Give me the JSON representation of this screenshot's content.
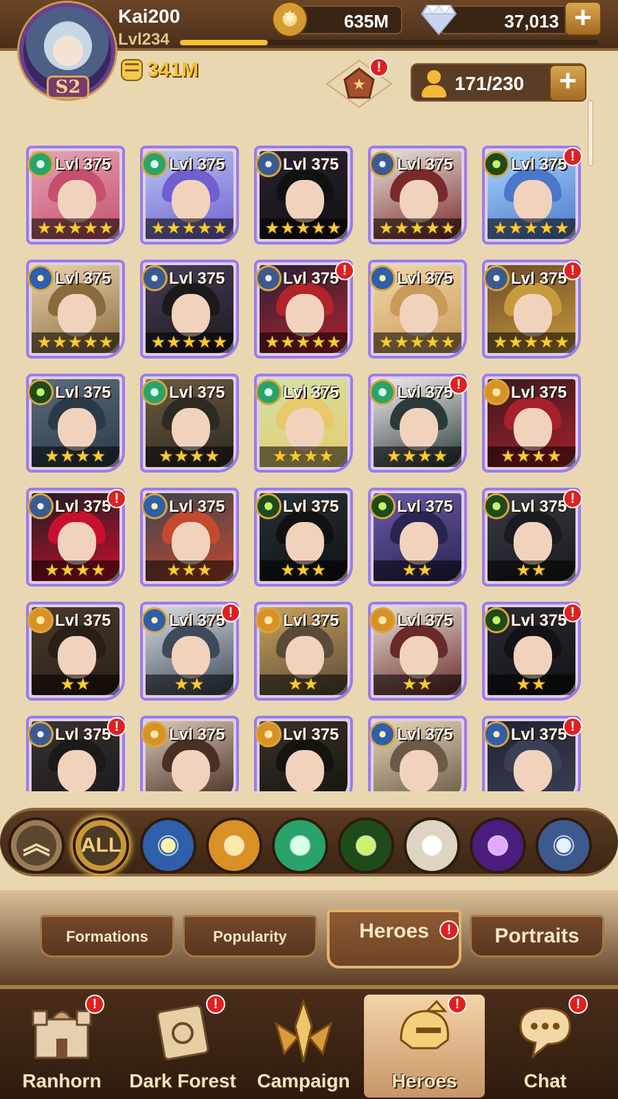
{
  "player": {
    "name": "Kai200",
    "level": "Lvl234",
    "season": "S2",
    "power": "341M",
    "xp_progress": 0.21
  },
  "resources": {
    "gold": "635M",
    "diamonds": "37,013",
    "hero_slots": "171/230"
  },
  "icons": {
    "gold": "gold-coin-icon",
    "diamond": "diamond-icon",
    "power": "fist-icon",
    "slots": "person-icon",
    "emblem": "emblem-icon"
  },
  "colors": {
    "alert": "#e02020",
    "card_border": "#9c7be8",
    "star": "#f8cd2f",
    "header": "#5a3a22"
  },
  "heroes": [
    {
      "level": "Lvl 375",
      "stars": "★★★★★",
      "faction": "wilder",
      "alert": false,
      "palette": [
        "#e7a3b6",
        "#c54f6d"
      ]
    },
    {
      "level": "Lvl 375",
      "stars": "★★★★★",
      "faction": "wilder",
      "alert": false,
      "palette": [
        "#b9c8f2",
        "#6f5fd0"
      ]
    },
    {
      "level": "Lvl 375",
      "stars": "★★★★★",
      "faction": "dimensional",
      "alert": false,
      "palette": [
        "#2a2130",
        "#111"
      ]
    },
    {
      "level": "Lvl 375",
      "stars": "★★★★★",
      "faction": "dimensional",
      "alert": false,
      "palette": [
        "#e9e4de",
        "#7a2a2a"
      ]
    },
    {
      "level": "Lvl 375",
      "stars": "★★★★★",
      "faction": "graveborn",
      "alert": true,
      "palette": [
        "#a8d6ff",
        "#4b77c9"
      ]
    },
    {
      "level": "Lvl 375",
      "stars": "★★★★★",
      "faction": "lightbearer",
      "alert": false,
      "palette": [
        "#e9d5b0",
        "#8a6b3d"
      ]
    },
    {
      "level": "Lvl 375",
      "stars": "★★★★★",
      "faction": "dimensional",
      "alert": false,
      "palette": [
        "#4a3b5e",
        "#1a1a1a"
      ]
    },
    {
      "level": "Lvl 375",
      "stars": "★★★★★",
      "faction": "dimensional",
      "alert": true,
      "palette": [
        "#27203a",
        "#b2232b"
      ]
    },
    {
      "level": "Lvl 375",
      "stars": "★★★★★",
      "faction": "lightbearer",
      "alert": false,
      "palette": [
        "#f2d8a8",
        "#c99a5a"
      ]
    },
    {
      "level": "Lvl 375",
      "stars": "★★★★★",
      "faction": "dimensional",
      "alert": true,
      "palette": [
        "#6b4a2a",
        "#c79a3c"
      ]
    },
    {
      "level": "Lvl 375",
      "stars": "★★★★",
      "faction": "graveborn",
      "alert": false,
      "palette": [
        "#5a6c7c",
        "#2a3a48"
      ]
    },
    {
      "level": "Lvl 375",
      "stars": "★★★★",
      "faction": "wilder",
      "alert": false,
      "palette": [
        "#6d5a3f",
        "#2d2a22"
      ]
    },
    {
      "level": "Lvl 375",
      "stars": "★★★★",
      "faction": "wilder",
      "alert": false,
      "palette": [
        "#cfe3a8",
        "#e9c86a"
      ]
    },
    {
      "level": "Lvl 375",
      "stars": "★★★★",
      "faction": "wilder",
      "alert": true,
      "palette": [
        "#f3eef0",
        "#2a3a3a"
      ]
    },
    {
      "level": "Lvl 375",
      "stars": "★★★★",
      "faction": "mauler",
      "alert": false,
      "palette": [
        "#3a1a1e",
        "#a7202c"
      ]
    },
    {
      "level": "Lvl 375",
      "stars": "★★★★",
      "faction": "dimensional",
      "alert": true,
      "palette": [
        "#1d1d24",
        "#c8102e"
      ]
    },
    {
      "level": "Lvl 375",
      "stars": "★★★",
      "faction": "lightbearer",
      "alert": false,
      "palette": [
        "#3a4450",
        "#c44a2d"
      ]
    },
    {
      "level": "Lvl 375",
      "stars": "★★★",
      "faction": "graveborn",
      "alert": false,
      "palette": [
        "#26323a",
        "#111"
      ]
    },
    {
      "level": "Lvl 375",
      "stars": "★★",
      "faction": "graveborn",
      "alert": false,
      "palette": [
        "#6a5aa8",
        "#2a2450"
      ]
    },
    {
      "level": "Lvl 375",
      "stars": "★★",
      "faction": "graveborn",
      "alert": true,
      "palette": [
        "#3a3a44",
        "#1a1a20"
      ]
    },
    {
      "level": "Lvl 375",
      "stars": "★★",
      "faction": "mauler",
      "alert": false,
      "palette": [
        "#4a3a2c",
        "#2a1f16"
      ]
    },
    {
      "level": "Lvl 375",
      "stars": "★★",
      "faction": "lightbearer",
      "alert": true,
      "palette": [
        "#d8dce0",
        "#3d4a5a"
      ]
    },
    {
      "level": "Lvl 375",
      "stars": "★★",
      "faction": "mauler",
      "alert": false,
      "palette": [
        "#caa25a",
        "#5a4a38"
      ]
    },
    {
      "level": "Lvl 375",
      "stars": "★★",
      "faction": "mauler",
      "alert": false,
      "palette": [
        "#e8e2d8",
        "#6a2a2a"
      ]
    },
    {
      "level": "Lvl 375",
      "stars": "★★",
      "faction": "graveborn",
      "alert": true,
      "palette": [
        "#2a2a32",
        "#121216"
      ]
    },
    {
      "level": "Lvl 375",
      "stars": "",
      "faction": "dimensional",
      "alert": true,
      "palette": [
        "#3a3232",
        "#1a1a1a"
      ]
    },
    {
      "level": "Lvl 375",
      "stars": "",
      "faction": "mauler",
      "alert": false,
      "palette": [
        "#d8c8b4",
        "#4a2f26"
      ]
    },
    {
      "level": "Lvl 375",
      "stars": "",
      "faction": "mauler",
      "alert": false,
      "palette": [
        "#3a3228",
        "#151310"
      ]
    },
    {
      "level": "Lvl 375",
      "stars": "",
      "faction": "lightbearer",
      "alert": false,
      "palette": [
        "#e8d8b8",
        "#6a5a48"
      ]
    },
    {
      "level": "Lvl 375",
      "stars": "",
      "faction": "lightbearer",
      "alert": true,
      "palette": [
        "#1f2230",
        "#3a3f55"
      ]
    }
  ],
  "filters": [
    {
      "name": "collapse",
      "label": "︽"
    },
    {
      "name": "all",
      "label": "ALL"
    },
    {
      "name": "lightbearer"
    },
    {
      "name": "mauler"
    },
    {
      "name": "wilder"
    },
    {
      "name": "graveborn"
    },
    {
      "name": "celestial"
    },
    {
      "name": "hypogean"
    },
    {
      "name": "dimensional"
    }
  ],
  "subtabs": [
    {
      "label": "Formations",
      "active": false,
      "alert": false
    },
    {
      "label": "Popularity",
      "active": false,
      "alert": false
    },
    {
      "label": "Heroes",
      "active": true,
      "alert": true
    },
    {
      "label": "Portraits",
      "active": false,
      "alert": false
    }
  ],
  "nav": [
    {
      "label": "Ranhorn",
      "alert": true,
      "icon": "castle-icon"
    },
    {
      "label": "Dark Forest",
      "alert": true,
      "icon": "scroll-map-icon"
    },
    {
      "label": "Campaign",
      "alert": false,
      "icon": "crossed-swords-icon"
    },
    {
      "label": "Heroes",
      "alert": true,
      "icon": "helmet-icon",
      "active": true
    },
    {
      "label": "Chat",
      "alert": true,
      "icon": "chat-bubble-icon"
    }
  ],
  "alert_symbol": "!"
}
